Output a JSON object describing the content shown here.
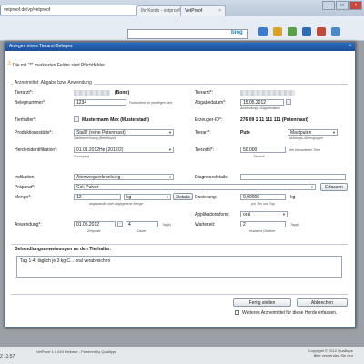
{
  "browser": {
    "url": "vetproof.de/vp/vetproof",
    "tabs": [
      {
        "label": "Ihr Konto - vetproof",
        "close": "×"
      },
      {
        "label": "VetProof",
        "close": "×"
      }
    ],
    "search_engine": "bing",
    "status_left": "VetProof 1.0.049 Release - Powered by Qualitype",
    "status_right_1": "Copyright © 2012 Qualitype",
    "status_right_2": "Bitte verwenden Sie den",
    "clock": "2 11:57"
  },
  "dialog": {
    "title": "Anlegen eines Tierarzt-Beleges",
    "close": "×",
    "note": "Die mit \"*\" markierten Felder sind Pflichtfelder.",
    "section_title": "Arzneimittel: Abgabe bzw. Anwendung",
    "fields": {
      "tierarzt_label": "Tierarzt*:",
      "tierarzt_value": "(Bonn)",
      "tierarzt2_label": "Tierarzt*:",
      "belegnummer_label": "Belegnummer*:",
      "belegnummer_value": "1234",
      "belegnummer_hint": "Fortlaufend, im jeweiligen Jahr",
      "abgabedatum_label": "Abgabedatum*:",
      "abgabedatum_value": "15.05.2012",
      "abgabedatum_hint": "Anwendungs-/Abgabedatum",
      "tierhalter_label": "Tierhalter*:",
      "tierhalter_value": "Mustermann Max (Musterstadt)",
      "erzeuger_label": "Erzeuger-ID*:",
      "erzeuger_value": "276 09 1 11 111   111 (Putenmast)",
      "produktionsstaette_label": "Produktionsstätte*:",
      "produktionsstaette_value": "Stall2 (reine Putenmast)",
      "produktionsstaette_hint": "Stallbezeichnung (Betriebsart)",
      "tierart_label": "Tierart*:",
      "tierart_value": "Pute",
      "nutzung_value": "Mastputen",
      "nutzung_hint": "Nutzungs-/Altersgruppe",
      "herdenident_label": "Herdenidentifikation*:",
      "herdenident_value": "01.01.2012He (2012/2)",
      "herdenident_hint": "Durchgang",
      "tierzahl_label": "Tierzahl*:",
      "tierzahl_value": "50.000",
      "tierzahl_suffix": "der behandelten Tiere",
      "tierzahl_hint": "Tierzahl",
      "indikation_label": "Indikation:",
      "indikation_value": "Atemwegserkrankung",
      "diagnose_label": "Diagnosedetails:",
      "praeparat_label": "Präparat*:",
      "praeparat_value": "Col;    Pulver",
      "erfassen_label": "Erfassen",
      "menge_label": "Menge*:",
      "menge_value": "12",
      "menge_unit": "kg",
      "menge_details": "Details",
      "menge_hint": "angewandte oder abgegebene Menge",
      "dosierung_label": "Dosierung:",
      "dosierung_value": "0,00006",
      "dosierung_unit": "kg",
      "dosierung_hint": "pro Tier und Tag",
      "applikation_label": "Applikationsform:",
      "applikation_value": "oral",
      "anwendung_label": "Anwendung*:",
      "anwendung_date": "01.05.2012",
      "anwendung_days": "4",
      "anwendung_days_unit": "Tag(e)",
      "anwendung_hint1": "Zeitpunkt",
      "anwendung_hint2": "Dauer",
      "wartezeit_label": "Wartezeit:",
      "wartezeit_value": "2",
      "wartezeit_unit": "Tag(e)",
      "wartezeit_hint": "essbares Gewebe",
      "anweisungen_label": "Behandlungsanweisungen an den Tierhalter:",
      "anweisungen_value": "Tag 1-4: täglich je 3 kg C...     oral verabreichen"
    },
    "buttons": {
      "fertig": "Fertig stellen",
      "abbrechen": "Abbrechen",
      "weitere": "Weiteres Arzneimittel für diese Herde erfassen."
    }
  }
}
